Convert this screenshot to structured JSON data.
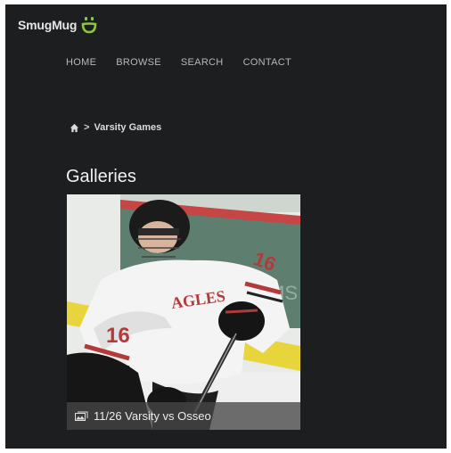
{
  "header": {
    "logo_text": "SmugMug"
  },
  "nav": {
    "items": [
      {
        "label": "HOME"
      },
      {
        "label": "BROWSE"
      },
      {
        "label": "SEARCH"
      },
      {
        "label": "CONTACT"
      }
    ]
  },
  "breadcrumb": {
    "separator": ">",
    "current": "Varsity Games"
  },
  "main": {
    "title": "Galleries",
    "galleries": [
      {
        "title": "11/26 Varsity vs Osseo"
      }
    ]
  },
  "colors": {
    "background": "#1d1e20",
    "logo_accent": "#8ec63f",
    "nav_text": "#b8b8b8"
  }
}
